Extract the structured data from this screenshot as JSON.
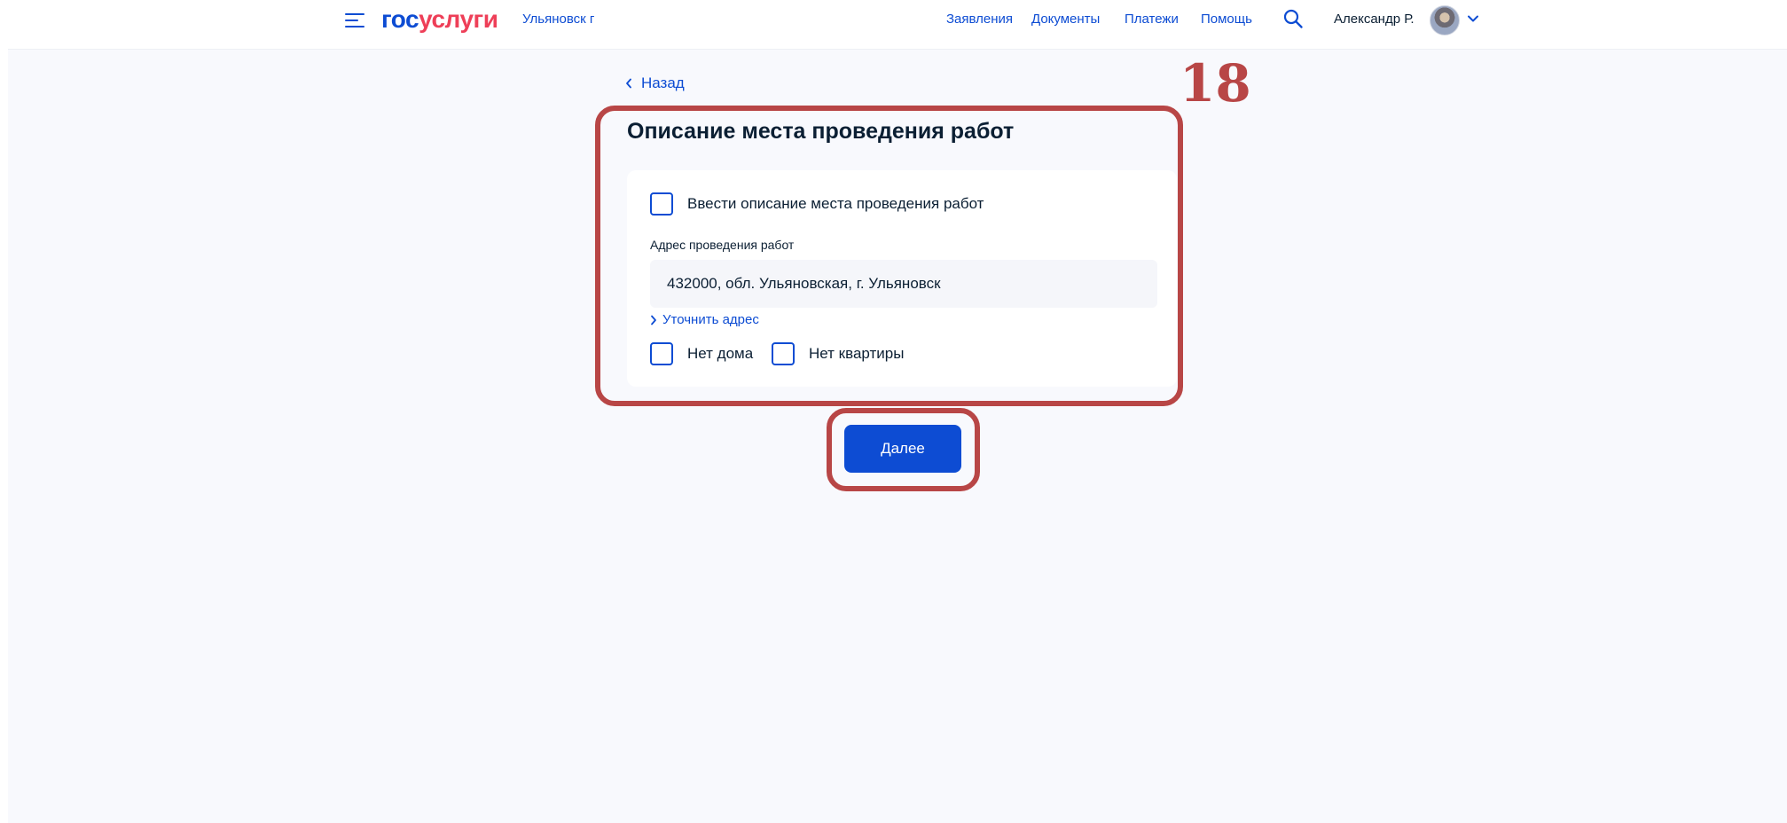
{
  "header": {
    "logo_part1": "гос",
    "logo_part2": "услуги",
    "city": "Ульяновск г",
    "nav": [
      "Заявления",
      "Документы",
      "Платежи",
      "Помощь"
    ],
    "user_name": "Александр Р.",
    "search_icon": "search-icon",
    "menu_icon": "burger-menu-icon"
  },
  "back_label": "Назад",
  "step_number": "18",
  "title": "Описание места проведения работ",
  "form": {
    "describe_checkbox_label": "Ввести описание места проведения работ",
    "address_label": "Адрес проведения работ",
    "address_value": "432000, обл. Ульяновская, г. Ульяновск",
    "clarify_link": "Уточнить адрес",
    "no_house_label": "Нет дома",
    "no_apartment_label": "Нет квартиры"
  },
  "next_button": "Далее",
  "colors": {
    "primary": "#0d4cd3",
    "logo_red": "#ee3f58",
    "annotation": "#b84646",
    "background": "#f8f9fd"
  }
}
